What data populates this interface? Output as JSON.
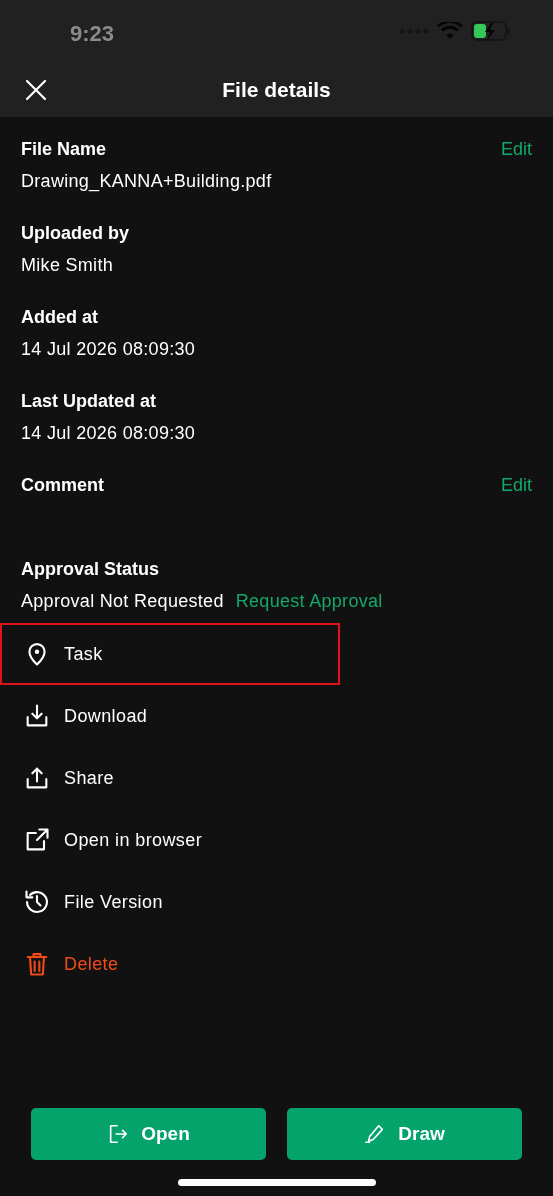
{
  "status_bar": {
    "time": "9:23"
  },
  "header": {
    "title": "File details"
  },
  "fields": [
    {
      "label": "File Name",
      "value": "Drawing_KANNA+Building.pdf",
      "action": "Edit"
    },
    {
      "label": "Uploaded by",
      "value": "Mike Smith"
    },
    {
      "label": "Added at",
      "value": "14 Jul 2026 08:09:30"
    },
    {
      "label": "Last Updated at",
      "value": "14 Jul 2026 08:09:30"
    },
    {
      "label": "Comment",
      "action": "Edit"
    }
  ],
  "approval": {
    "label": "Approval Status",
    "value": "Approval Not Requested",
    "link": "Request Approval"
  },
  "actions": [
    {
      "kind": "pin",
      "label": "Task",
      "highlighted": true,
      "danger": false
    },
    {
      "kind": "download",
      "label": "Download",
      "highlighted": false,
      "danger": false
    },
    {
      "kind": "share",
      "label": "Share",
      "highlighted": false,
      "danger": false
    },
    {
      "kind": "external",
      "label": "Open in browser",
      "highlighted": false,
      "danger": false
    },
    {
      "kind": "history",
      "label": "File Version",
      "highlighted": false,
      "danger": false
    },
    {
      "kind": "trash",
      "label": "Delete",
      "highlighted": false,
      "danger": true
    }
  ],
  "buttons": [
    {
      "kind": "open",
      "label": "Open"
    },
    {
      "kind": "draw",
      "label": "Draw"
    }
  ]
}
